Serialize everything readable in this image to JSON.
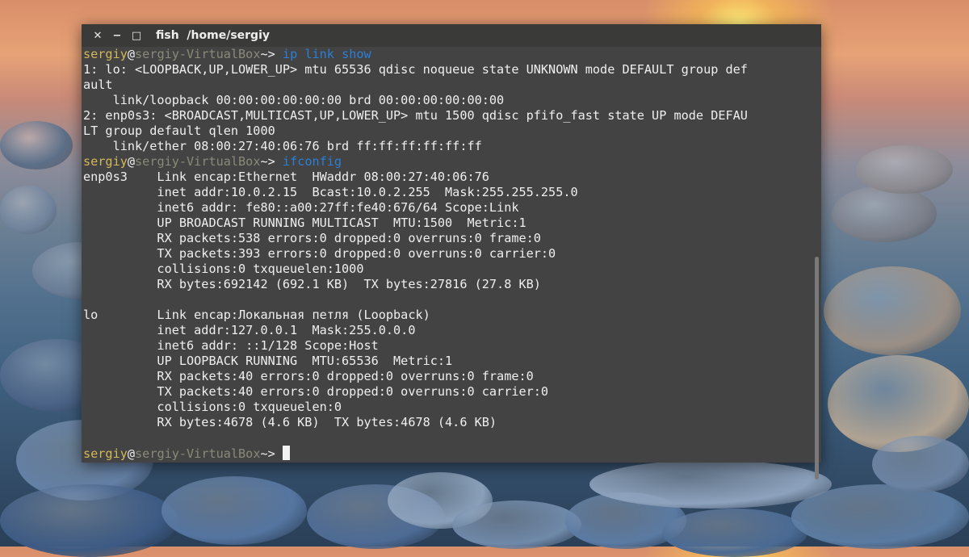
{
  "window": {
    "title": "fish  /home/sergiy",
    "controls": {
      "close": "✕",
      "minimize": "−",
      "maximize": "□"
    }
  },
  "prompt": {
    "user": "sergiy",
    "at": "@",
    "host": "sergiy-VirtualBox",
    "symbol": "~> "
  },
  "terminal_lines": [
    {
      "kind": "prompt",
      "cmd": "ip link show"
    },
    {
      "kind": "out",
      "text": "1: lo: <LOOPBACK,UP,LOWER_UP> mtu 65536 qdisc noqueue state UNKNOWN mode DEFAULT group def"
    },
    {
      "kind": "out",
      "text": "ault"
    },
    {
      "kind": "out",
      "text": "    link/loopback 00:00:00:00:00:00 brd 00:00:00:00:00:00"
    },
    {
      "kind": "out",
      "text": "2: enp0s3: <BROADCAST,MULTICAST,UP,LOWER_UP> mtu 1500 qdisc pfifo_fast state UP mode DEFAU"
    },
    {
      "kind": "out",
      "text": "LT group default qlen 1000"
    },
    {
      "kind": "out",
      "text": "    link/ether 08:00:27:40:06:76 brd ff:ff:ff:ff:ff:ff"
    },
    {
      "kind": "prompt",
      "cmd": "ifconfig"
    },
    {
      "kind": "out",
      "text": "enp0s3    Link encap:Ethernet  HWaddr 08:00:27:40:06:76"
    },
    {
      "kind": "out",
      "text": "          inet addr:10.0.2.15  Bcast:10.0.2.255  Mask:255.255.255.0"
    },
    {
      "kind": "out",
      "text": "          inet6 addr: fe80::a00:27ff:fe40:676/64 Scope:Link"
    },
    {
      "kind": "out",
      "text": "          UP BROADCAST RUNNING MULTICAST  MTU:1500  Metric:1"
    },
    {
      "kind": "out",
      "text": "          RX packets:538 errors:0 dropped:0 overruns:0 frame:0"
    },
    {
      "kind": "out",
      "text": "          TX packets:393 errors:0 dropped:0 overruns:0 carrier:0"
    },
    {
      "kind": "out",
      "text": "          collisions:0 txqueuelen:1000"
    },
    {
      "kind": "out",
      "text": "          RX bytes:692142 (692.1 KB)  TX bytes:27816 (27.8 KB)"
    },
    {
      "kind": "out",
      "text": ""
    },
    {
      "kind": "out",
      "text": "lo        Link encap:Локальная петля (Loopback)"
    },
    {
      "kind": "out",
      "text": "          inet addr:127.0.0.1  Mask:255.0.0.0"
    },
    {
      "kind": "out",
      "text": "          inet6 addr: ::1/128 Scope:Host"
    },
    {
      "kind": "out",
      "text": "          UP LOOPBACK RUNNING  MTU:65536  Metric:1"
    },
    {
      "kind": "out",
      "text": "          RX packets:40 errors:0 dropped:0 overruns:0 frame:0"
    },
    {
      "kind": "out",
      "text": "          TX packets:40 errors:0 dropped:0 overruns:0 carrier:0"
    },
    {
      "kind": "out",
      "text": "          collisions:0 txqueuelen:0"
    },
    {
      "kind": "out",
      "text": "          RX bytes:4678 (4.6 KB)  TX bytes:4678 (4.6 KB)"
    },
    {
      "kind": "out",
      "text": ""
    },
    {
      "kind": "prompt",
      "cmd": "",
      "cursor": true
    }
  ],
  "colors": {
    "terminal_bg": "#434343",
    "titlebar_bg": "#3a3a38",
    "text": "#efefef",
    "prompt_user": "#d4b85a",
    "prompt_host": "#8a8a7a",
    "command": "#2b7fd6"
  }
}
